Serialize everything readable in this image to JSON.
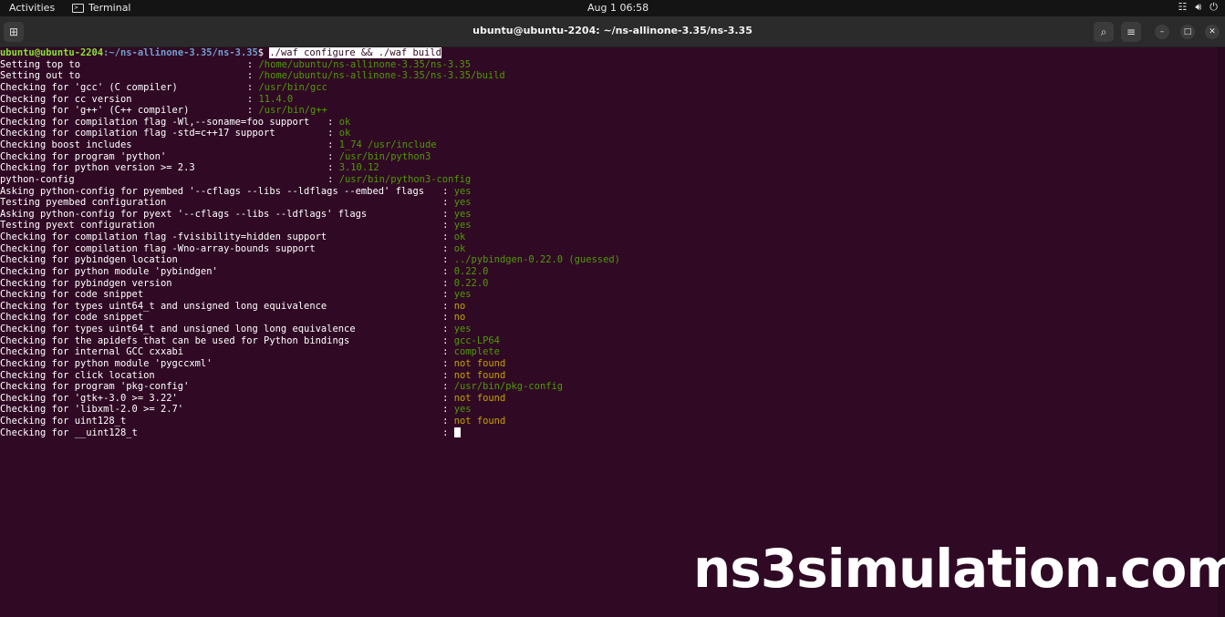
{
  "topbar": {
    "activities": "Activities",
    "app_name": "Terminal",
    "clock": "Aug 1  06:58"
  },
  "window": {
    "title": "ubuntu@ubuntu-2204: ~/ns-allinone-3.35/ns-3.35"
  },
  "prompt": {
    "user_host": "ubuntu@ubuntu-2204",
    "path": ":~/ns-allinone-3.35/ns-3.35",
    "symbol": "$ ",
    "command": "./waf configure && ./waf build"
  },
  "groups": [
    {
      "colon_col": 43,
      "lines": [
        {
          "label": "Setting top to",
          "value": "/home/ubuntu/ns-allinone-3.35/ns-3.35",
          "color": "green"
        },
        {
          "label": "Setting out to",
          "value": "/home/ubuntu/ns-allinone-3.35/ns-3.35/build",
          "color": "green"
        },
        {
          "label": "Checking for 'gcc' (C compiler)",
          "value": "/usr/bin/gcc",
          "color": "green"
        },
        {
          "label": "Checking for cc version",
          "value": "11.4.0",
          "color": "green"
        },
        {
          "label": "Checking for 'g++' (C++ compiler)",
          "value": "/usr/bin/g++",
          "color": "green"
        }
      ]
    },
    {
      "colon_col": 57,
      "lines": [
        {
          "label": "Checking for compilation flag -Wl,--soname=foo support",
          "value": "ok",
          "color": "green"
        },
        {
          "label": "Checking for compilation flag -std=c++17 support",
          "value": "ok",
          "color": "green"
        },
        {
          "label": "Checking boost includes",
          "value": "1_74 /usr/include",
          "color": "green"
        },
        {
          "label": "Checking for program 'python'",
          "value": "/usr/bin/python3",
          "color": "green"
        },
        {
          "label": "Checking for python version >= 2.3",
          "value": "3.10.12",
          "color": "green"
        },
        {
          "label": "python-config",
          "value": "/usr/bin/python3-config",
          "color": "green"
        }
      ]
    },
    {
      "colon_col": 77,
      "lines": [
        {
          "label": "Asking python-config for pyembed '--cflags --libs --ldflags --embed' flags",
          "value": "yes",
          "color": "green"
        },
        {
          "label": "Testing pyembed configuration",
          "value": "yes",
          "color": "green"
        },
        {
          "label": "Asking python-config for pyext '--cflags --libs --ldflags' flags",
          "value": "yes",
          "color": "green"
        },
        {
          "label": "Testing pyext configuration",
          "value": "yes",
          "color": "green"
        },
        {
          "label": "Checking for compilation flag -fvisibility=hidden support",
          "value": "ok",
          "color": "green"
        },
        {
          "label": "Checking for compilation flag -Wno-array-bounds support",
          "value": "ok",
          "color": "green"
        },
        {
          "label": "Checking for pybindgen location",
          "value": "../pybindgen-0.22.0 (guessed)",
          "color": "green"
        },
        {
          "label": "Checking for python module 'pybindgen'",
          "value": "0.22.0",
          "color": "green"
        },
        {
          "label": "Checking for pybindgen version",
          "value": "0.22.0",
          "color": "green"
        },
        {
          "label": "Checking for code snippet",
          "value": "yes",
          "color": "green"
        },
        {
          "label": "Checking for types uint64_t and unsigned long equivalence",
          "value": "no",
          "color": "yellow"
        },
        {
          "label": "Checking for code snippet",
          "value": "no",
          "color": "yellow"
        },
        {
          "label": "Checking for types uint64_t and unsigned long long equivalence",
          "value": "yes",
          "color": "green"
        },
        {
          "label": "Checking for the apidefs that can be used for Python bindings",
          "value": "gcc-LP64",
          "color": "green"
        },
        {
          "label": "Checking for internal GCC cxxabi",
          "value": "complete",
          "color": "green"
        },
        {
          "label": "Checking for python module 'pygccxml'",
          "value": "not found",
          "color": "yellow"
        },
        {
          "label": "Checking for click location",
          "value": "not found",
          "color": "yellow"
        },
        {
          "label": "Checking for program 'pkg-config'",
          "value": "/usr/bin/pkg-config",
          "color": "green"
        },
        {
          "label": "Checking for 'gtk+-3.0 >= 3.22'",
          "value": "not found",
          "color": "yellow"
        },
        {
          "label": "Checking for 'libxml-2.0 >= 2.7'",
          "value": "yes",
          "color": "green"
        },
        {
          "label": "Checking for uint128_t",
          "value": "not found",
          "color": "yellow"
        },
        {
          "label": "Checking for __uint128_t",
          "value": "",
          "color": "cursor"
        }
      ]
    }
  ],
  "colors": {
    "background": "#300a24",
    "ok_green": "#4e9a06",
    "warn_yellow": "#c4a000",
    "prompt_user": "#8ae234",
    "prompt_path": "#729fcf"
  },
  "watermark": "ns3simulation.com"
}
